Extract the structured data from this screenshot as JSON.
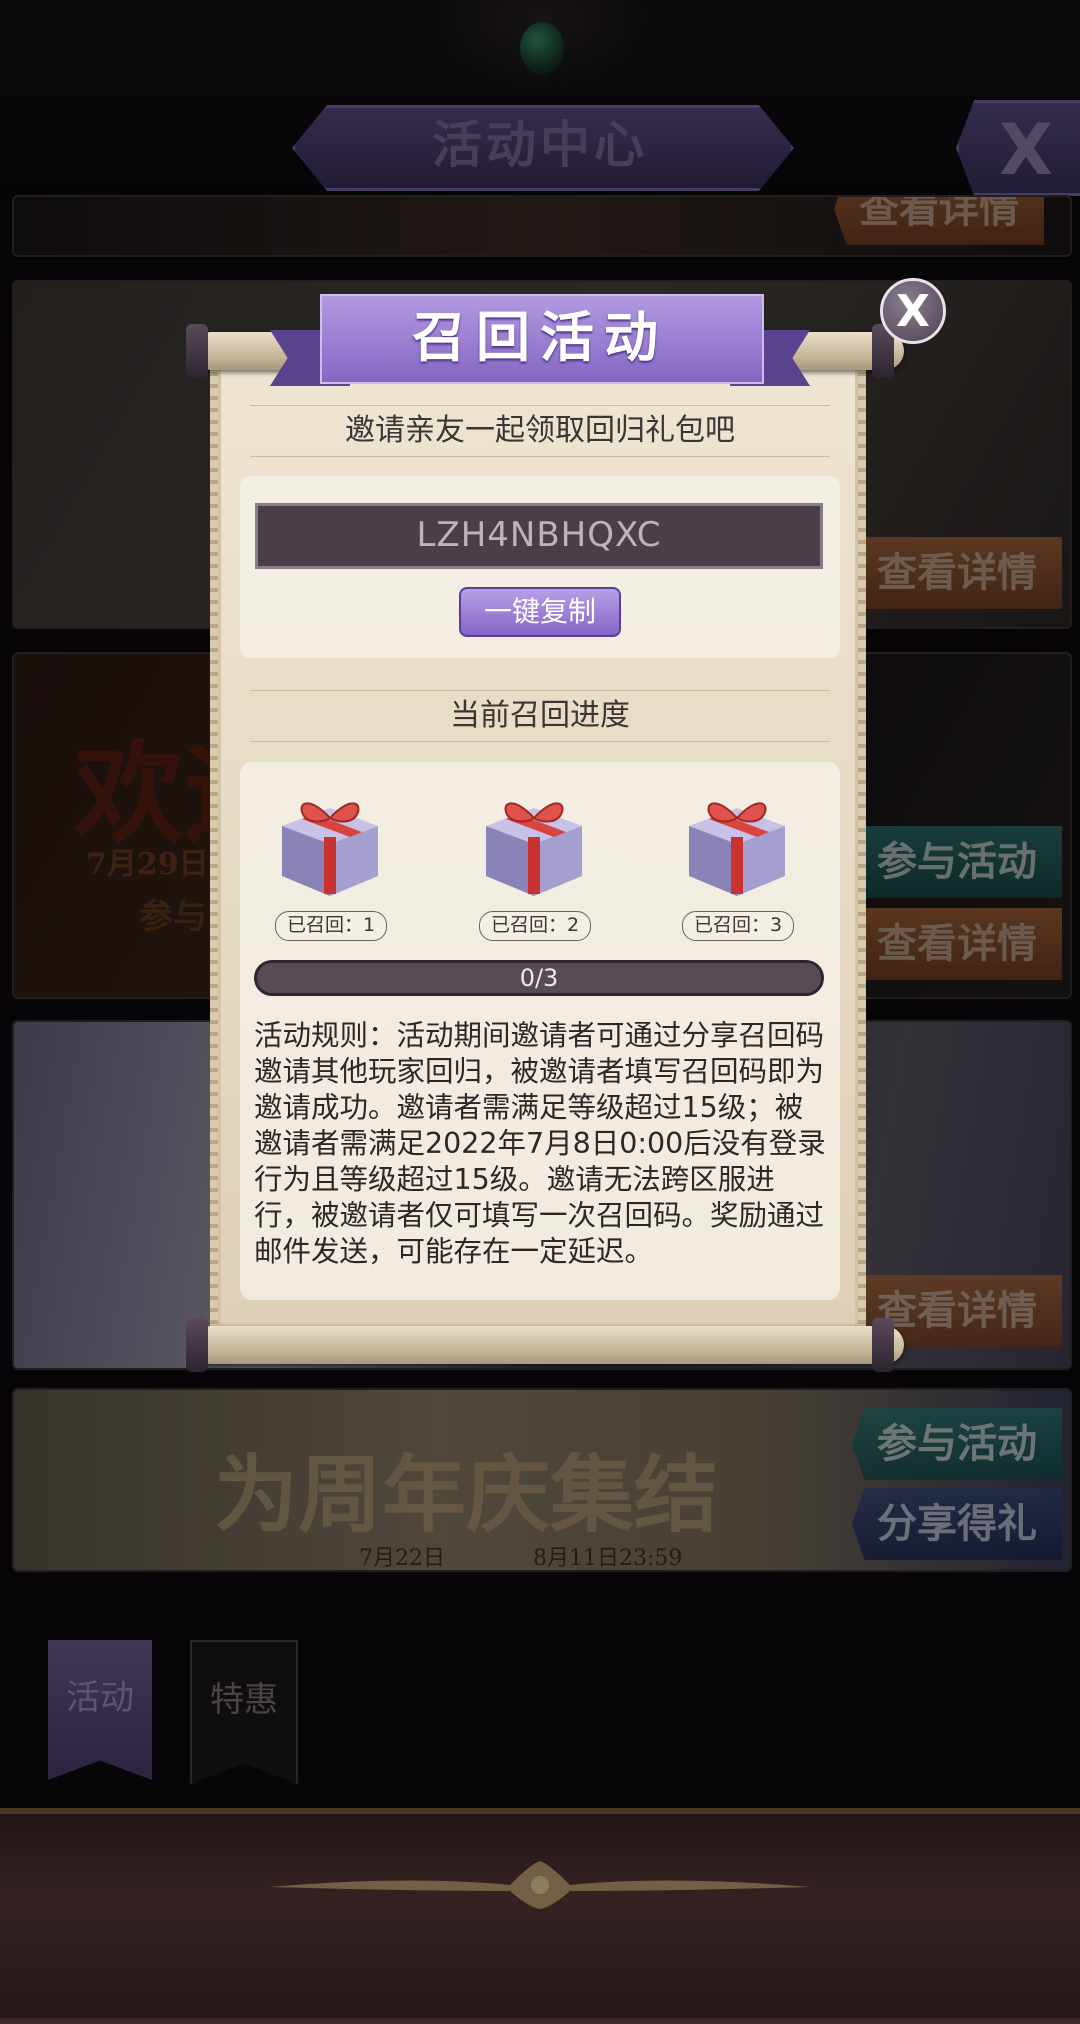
{
  "header": {
    "title": "活动中心",
    "close_label": "X"
  },
  "banners": {
    "welcome_text": "欢迎",
    "welcome_date": "7月29日0",
    "welcome_join_stub": "参与",
    "anniversary_text": "为周年庆集结",
    "anniversary_date": "7月22日　　　　8月11日23:59"
  },
  "banner_buttons": {
    "view_details": "查看详情",
    "join_activity": "参与活动",
    "share_gift": "分享得礼"
  },
  "tabs": [
    {
      "label": "活动",
      "active": true
    },
    {
      "label": "特惠",
      "active": false
    }
  ],
  "popup": {
    "title": "召回活动",
    "close_label": "X",
    "subtitle": "邀请亲友一起领取回归礼包吧",
    "invite_code": "LZH4NBHQXC",
    "copy_button": "一键复制",
    "progress_title": "当前召回进度",
    "gifts": [
      {
        "label": "已召回：1",
        "icon": "gift-box-icon"
      },
      {
        "label": "已召回：2",
        "icon": "gift-box-icon"
      },
      {
        "label": "已召回：3",
        "icon": "gift-box-icon"
      }
    ],
    "progress": {
      "current": 0,
      "total": 3,
      "text": "0/3"
    },
    "rules": "活动规则：活动期间邀请者可通过分享召回码邀请其他玩家回归，被邀请者填写召回码即为邀请成功。邀请者需满足等级超过15级；被邀请者需满足2022年7月8日0:00后没有登录行为且等级超过15级。邀请无法跨区服进行，被邀请者仅可填写一次召回码。奖励通过邮件发送，可能存在一定延迟。"
  },
  "colors": {
    "accent_purple": "#8c73c8",
    "paper": "#e9dfcb",
    "dark_bg": "#0d0a0e"
  }
}
